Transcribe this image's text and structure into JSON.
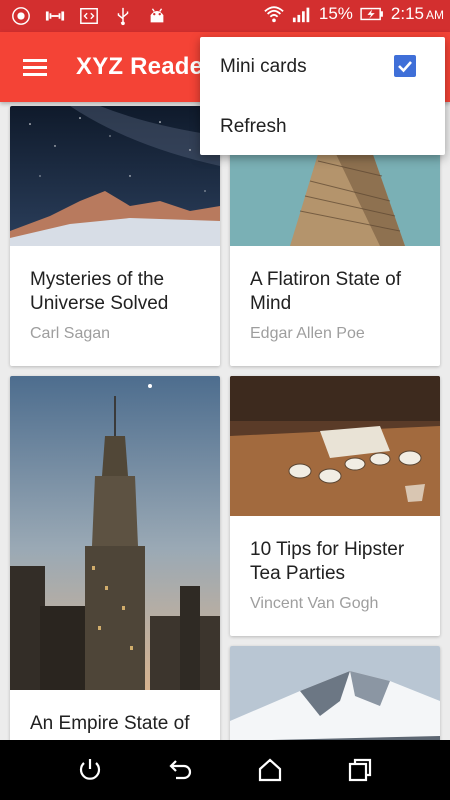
{
  "status_bar": {
    "icons": [
      "badge-icon",
      "dumbbell-icon",
      "code-icon",
      "usb-icon",
      "android-icon",
      "wifi-icon",
      "signal-icon",
      "battery-charging-icon"
    ],
    "battery": "15%",
    "time": "2:15",
    "ampm": "AM"
  },
  "app_bar": {
    "title": "XYZ Reader",
    "menu_icon": "hamburger-menu-icon",
    "color": "#f44336",
    "status_color": "#d32f2f"
  },
  "overflow_menu": {
    "items": [
      {
        "label": "Mini cards",
        "checked": true
      },
      {
        "label": "Refresh"
      }
    ]
  },
  "articles": [
    {
      "title": "Mysteries of the Universe Solved",
      "author": "Carl Sagan",
      "image": "milky-way-mountains"
    },
    {
      "title": "A Flatiron State of Mind",
      "author": "Edgar Allen Poe",
      "image": "flatiron-building"
    },
    {
      "title": "An Empire State of",
      "author": "",
      "image": "empire-state-building"
    },
    {
      "title": "10 Tips for Hipster Tea Parties",
      "author": "Vincent Van Gogh",
      "image": "tea-cups-table"
    },
    {
      "title": "",
      "author": "",
      "image": "snowy-mountain"
    }
  ],
  "nav_bar": {
    "icons": [
      "power-icon",
      "back-icon",
      "home-icon",
      "recents-icon"
    ]
  }
}
